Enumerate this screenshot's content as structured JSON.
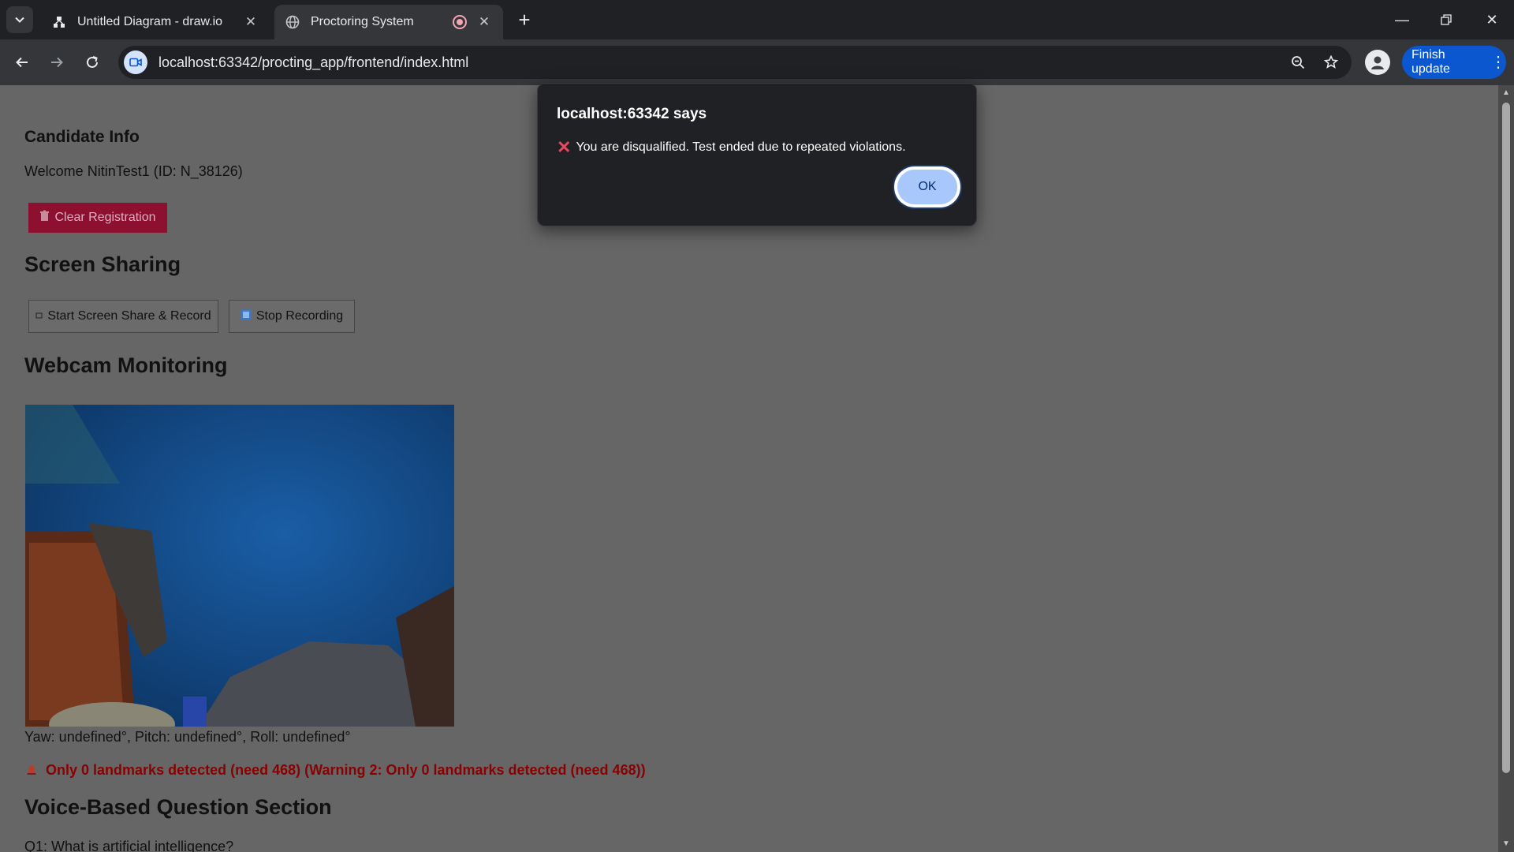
{
  "browser": {
    "tabs": [
      {
        "title": "Untitled Diagram - draw.io",
        "icon": "drawio-icon"
      },
      {
        "title": "Proctoring System",
        "icon": "globe-icon",
        "recording": true
      }
    ],
    "url": "localhost:63342/procting_app/frontend/index.html",
    "finish_update_label": "Finish update"
  },
  "page": {
    "candidate_heading": "Candidate Info",
    "welcome_text": "Welcome NitinTest1 (ID: N_38126)",
    "clear_registration_label": "Clear Registration",
    "screen_sharing_heading": "Screen Sharing",
    "start_share_label": "Start Screen Share & Record",
    "stop_recording_label": "Stop Recording",
    "webcam_heading": "Webcam Monitoring",
    "pose_text": "Yaw: undefined°, Pitch: undefined°, Roll: undefined°",
    "alert_text": "Only 0 landmarks detected (need 468) (Warning 2: Only 0 landmarks detected (need 468))",
    "voice_heading": "Voice-Based Question Section",
    "question_1": "Q1: What is artificial intelligence?"
  },
  "dialog": {
    "title": "localhost:63342 says",
    "message": "You are disqualified. Test ended due to repeated violations.",
    "ok_label": "OK"
  },
  "colors": {
    "accent": "#0b57d0",
    "clear_button": "#8e1030",
    "alert_text": "#8b0000",
    "dialog_bg": "#202124",
    "ok_button": "#a8c7fa"
  }
}
